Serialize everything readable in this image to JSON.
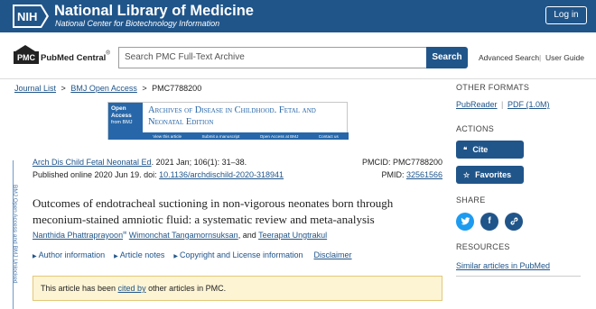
{
  "header": {
    "logo_text": "NIH",
    "title": "National Library of Medicine",
    "subtitle": "National Center for Biotechnology Information",
    "login_label": "Log in",
    "brand_color": "#20558a"
  },
  "pmc_bar": {
    "logo_badge": "PMC",
    "logo_text": "PubMed Central",
    "search_placeholder": "Search PMC Full-Text Archive",
    "search_button": "Search",
    "advanced_search": "Advanced Search",
    "separator": "|",
    "user_guide": "User Guide"
  },
  "breadcrumb": {
    "items": [
      "Journal List",
      "BMJ Open Access",
      "PMC7788200"
    ],
    "separator": ">"
  },
  "journal_banner": {
    "oa_line1": "Open",
    "oa_line2": "Access",
    "oa_line3": "from BMJ",
    "title": "Archives of Disease in Childhood. Fetal and Neonatal Edition",
    "links": [
      "View this article",
      "Submit a manuscript",
      "Open Access at BMJ",
      "Contact us"
    ]
  },
  "citation": {
    "journal_link": "Arch Dis Child Fetal Neonatal Ed",
    "journal_rest": ". 2021 Jan; 106(1): 31–38.",
    "published": "Published online 2020 Jun 19. doi: ",
    "doi": "10.1136/archdischild-2020-318941",
    "pmcid_label": "PMCID: PMC7788200",
    "pmid_label": "PMID: ",
    "pmid": "32561566"
  },
  "article": {
    "title": "Outcomes of endotracheal suctioning in non-vigorous neonates born through meconium-stained amniotic fluid: a systematic review and meta-analysis",
    "author1": "Nanthida Phattraprayoon",
    "author_mark": "✉",
    "author2": "Wimonchat Tangamornsuksan",
    "and": "and",
    "author3": "Teerapat Ungtrakul"
  },
  "info_links": {
    "author_info": "Author information",
    "article_notes": "Article notes",
    "copyright": "Copyright and License information",
    "disclaimer": "Disclaimer"
  },
  "cited_box": {
    "prefix": "This article has been ",
    "link": "cited by",
    "suffix": " other articles in PMC."
  },
  "vertical_strip": {
    "text": "BMJ Open Access and BMJ Unlocked"
  },
  "right_column": {
    "other_formats_heading": "OTHER FORMATS",
    "pubreader": "PubReader",
    "pdf": "PDF (1.0M)",
    "actions_heading": "ACTIONS",
    "cite_label": "Cite",
    "favorites_label": "Favorites",
    "share_heading": "SHARE",
    "resources_heading": "RESOURCES",
    "similar_articles": "Similar articles in PubMed",
    "twitter_color": "#1d9bf0",
    "facebook_color": "#20558a",
    "link_color": "#20558a"
  }
}
